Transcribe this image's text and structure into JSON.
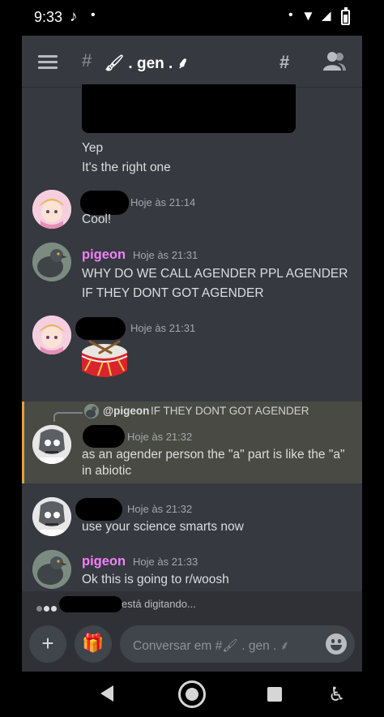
{
  "status_bar": {
    "time": "9:33",
    "tiktok_glyph": "♪",
    "dot": "•",
    "right_dot": "•",
    "wifi_glyph": "▼",
    "signal_glyph": "◢"
  },
  "header": {
    "hash": "#",
    "channel_name": "🖌 . gen . ⸙",
    "threads_glyph": "#"
  },
  "messages": [
    {
      "continuation_lines": [
        "Yep",
        "It's the right one"
      ]
    },
    {
      "author": "",
      "timestamp": "Hoje às 21:14",
      "text": "Cool!"
    },
    {
      "author": "pigeon",
      "author_color": "#f47fff",
      "timestamp": "Hoje às 21:31",
      "text_lines": [
        "WHY DO WE CALL AGENDER PPL AGENDER",
        "IF THEY DONT GOT AGENDER"
      ]
    },
    {
      "author": "",
      "timestamp": "Hoje às 21:31",
      "content": "🥁"
    },
    {
      "reply_to": {
        "mention": "@pigeon",
        "text": "IF THEY DONT GOT AGENDER"
      },
      "author": "",
      "timestamp": "Hoje às 21:32",
      "text_lines": [
        "as an agender person the \"a\" part is like the \"a\"",
        "in abiotic"
      ],
      "highlight_color": "#e3a13a"
    },
    {
      "author": "",
      "timestamp": "Hoje às 21:32",
      "text": "use your science smarts now"
    },
    {
      "author": "pigeon",
      "author_color": "#f47fff",
      "timestamp": "Hoje às 21:33",
      "text": "Ok this is going to r/woosh"
    }
  ],
  "typing": {
    "text": "está digitando..."
  },
  "composer": {
    "add_glyph": "+",
    "gift_glyph": "🎁",
    "placeholder": "Conversar em #🖌 . gen . ⸙"
  },
  "nav": {
    "accessibility_glyph": "♿"
  },
  "colors": {
    "background": "#36393f",
    "composer": "#2f3136",
    "accent_reply": "#e3a13a",
    "pigeon": "#f47fff"
  }
}
